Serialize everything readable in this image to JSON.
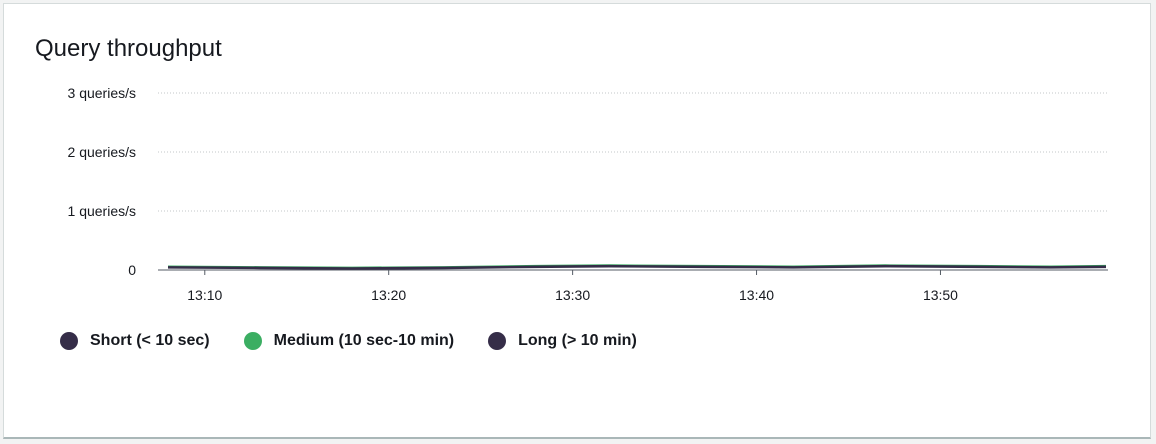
{
  "panel": {
    "title": "Query throughput"
  },
  "chart_data": {
    "type": "line",
    "title": "Query throughput",
    "xlabel": "",
    "ylabel": "",
    "ylim": [
      0,
      3
    ],
    "xlim": [
      "13:08",
      "13:59"
    ],
    "y_ticks": [
      {
        "value": 0,
        "label": "0"
      },
      {
        "value": 1,
        "label": "1 queries/s"
      },
      {
        "value": 2,
        "label": "2 queries/s"
      },
      {
        "value": 3,
        "label": "3 queries/s"
      }
    ],
    "x_ticks": [
      "13:10",
      "13:20",
      "13:30",
      "13:40",
      "13:50"
    ],
    "grid": true,
    "legend_position": "bottom-left",
    "x": [
      "13:08",
      "13:13",
      "13:18",
      "13:23",
      "13:28",
      "13:32",
      "13:37",
      "13:42",
      "13:47",
      "13:52",
      "13:56",
      "13:59"
    ],
    "series": [
      {
        "name": "Short (< 10 sec)",
        "color": "#352d48",
        "values": [
          0.05,
          0.04,
          0.03,
          0.04,
          0.06,
          0.07,
          0.06,
          0.05,
          0.07,
          0.06,
          0.05,
          0.06
        ]
      },
      {
        "name": "Medium (10 sec-10 min)",
        "color": "#3bae62",
        "values": [
          0.06,
          0.05,
          0.04,
          0.05,
          0.07,
          0.08,
          0.07,
          0.06,
          0.08,
          0.07,
          0.06,
          0.07
        ]
      },
      {
        "name": "Long (> 10 min)",
        "color": "#352d48",
        "values": [
          0.04,
          0.03,
          0.02,
          0.03,
          0.05,
          0.06,
          0.05,
          0.04,
          0.06,
          0.05,
          0.04,
          0.05
        ]
      }
    ]
  }
}
